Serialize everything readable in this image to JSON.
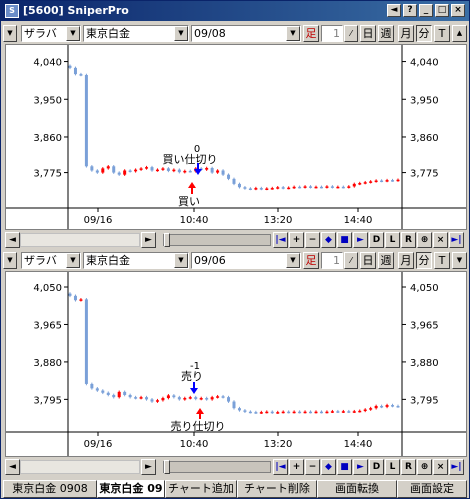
{
  "window": {
    "title": "[5600] SniperPro",
    "buttons": [
      "◄",
      "?",
      "_",
      "□",
      "×"
    ]
  },
  "panels": [
    {
      "mode_select": "ザラバ",
      "market_select": "東京白金",
      "month_select": "09/08",
      "btn_ashi": "足",
      "btn_tick": "1",
      "btn_day": "日",
      "btn_week": "週",
      "btn_month": "月",
      "btn_minute": "分",
      "btn_t": "T",
      "y_ticks": [
        "4,040",
        "3,950",
        "3,860",
        "3,775"
      ],
      "x_ticks": [
        "09/16",
        "10:40",
        "13:20",
        "14:40"
      ],
      "annotations": {
        "count": "0",
        "exit": "買い仕切り",
        "entry": "買い"
      },
      "chart_data": {
        "type": "candlestick",
        "y_ticks": [
          4040,
          3950,
          3860,
          3775
        ],
        "ylim": [
          3700,
          4070
        ],
        "closes": [
          4025,
          4010,
          4008,
          3790,
          3780,
          3775,
          3785,
          3790,
          3775,
          3770,
          3780,
          3778,
          3782,
          3785,
          3788,
          3780,
          3782,
          3785,
          3779,
          3782,
          3776,
          3779,
          3778,
          3785,
          3782,
          3786,
          3775,
          3780,
          3770,
          3760,
          3748,
          3740,
          3737,
          3736,
          3738,
          3736,
          3737,
          3738,
          3740,
          3738,
          3739,
          3741,
          3740,
          3742,
          3740,
          3741,
          3740,
          3742,
          3740,
          3741,
          3740,
          3742,
          3748,
          3750,
          3752,
          3754,
          3756,
          3755,
          3757,
          3756,
          3758
        ]
      }
    },
    {
      "mode_select": "ザラバ",
      "market_select": "東京白金",
      "month_select": "09/06",
      "btn_ashi": "足",
      "btn_tick": "1",
      "btn_day": "日",
      "btn_week": "週",
      "btn_month": "月",
      "btn_minute": "分",
      "btn_t": "T",
      "y_ticks": [
        "4,050",
        "3,965",
        "3,880",
        "3,795"
      ],
      "x_ticks": [
        "09/16",
        "10:40",
        "13:20",
        "14:40"
      ],
      "annotations": {
        "count": "-1",
        "entry": "売り",
        "exit": "売り仕切り"
      },
      "chart_data": {
        "type": "candlestick",
        "y_ticks": [
          4050,
          3965,
          3880,
          3795
        ],
        "ylim": [
          3730,
          4075
        ],
        "closes": [
          4030,
          4020,
          4022,
          3830,
          3820,
          3815,
          3810,
          3805,
          3800,
          3812,
          3805,
          3800,
          3798,
          3800,
          3795,
          3790,
          3793,
          3798,
          3804,
          3800,
          3795,
          3798,
          3800,
          3796,
          3798,
          3795,
          3800,
          3802,
          3800,
          3790,
          3775,
          3770,
          3767,
          3766,
          3765,
          3766,
          3767,
          3765,
          3766,
          3767,
          3766,
          3767,
          3766,
          3767,
          3766,
          3767,
          3766,
          3767,
          3768,
          3767,
          3768,
          3767,
          3768,
          3769,
          3772,
          3775,
          3780,
          3778,
          3782,
          3780,
          3779
        ]
      }
    }
  ],
  "nav": {
    "buttons": [
      "◄",
      "►",
      "|◄",
      "+",
      "−",
      "◆",
      "■",
      "►",
      "D",
      "L",
      "R",
      "⊕",
      "×",
      "►|"
    ]
  },
  "tabs": [
    "東京白金 0908",
    "東京白金 09",
    "チャート追加",
    "チャート削除",
    "画面転換",
    "画面設定"
  ]
}
